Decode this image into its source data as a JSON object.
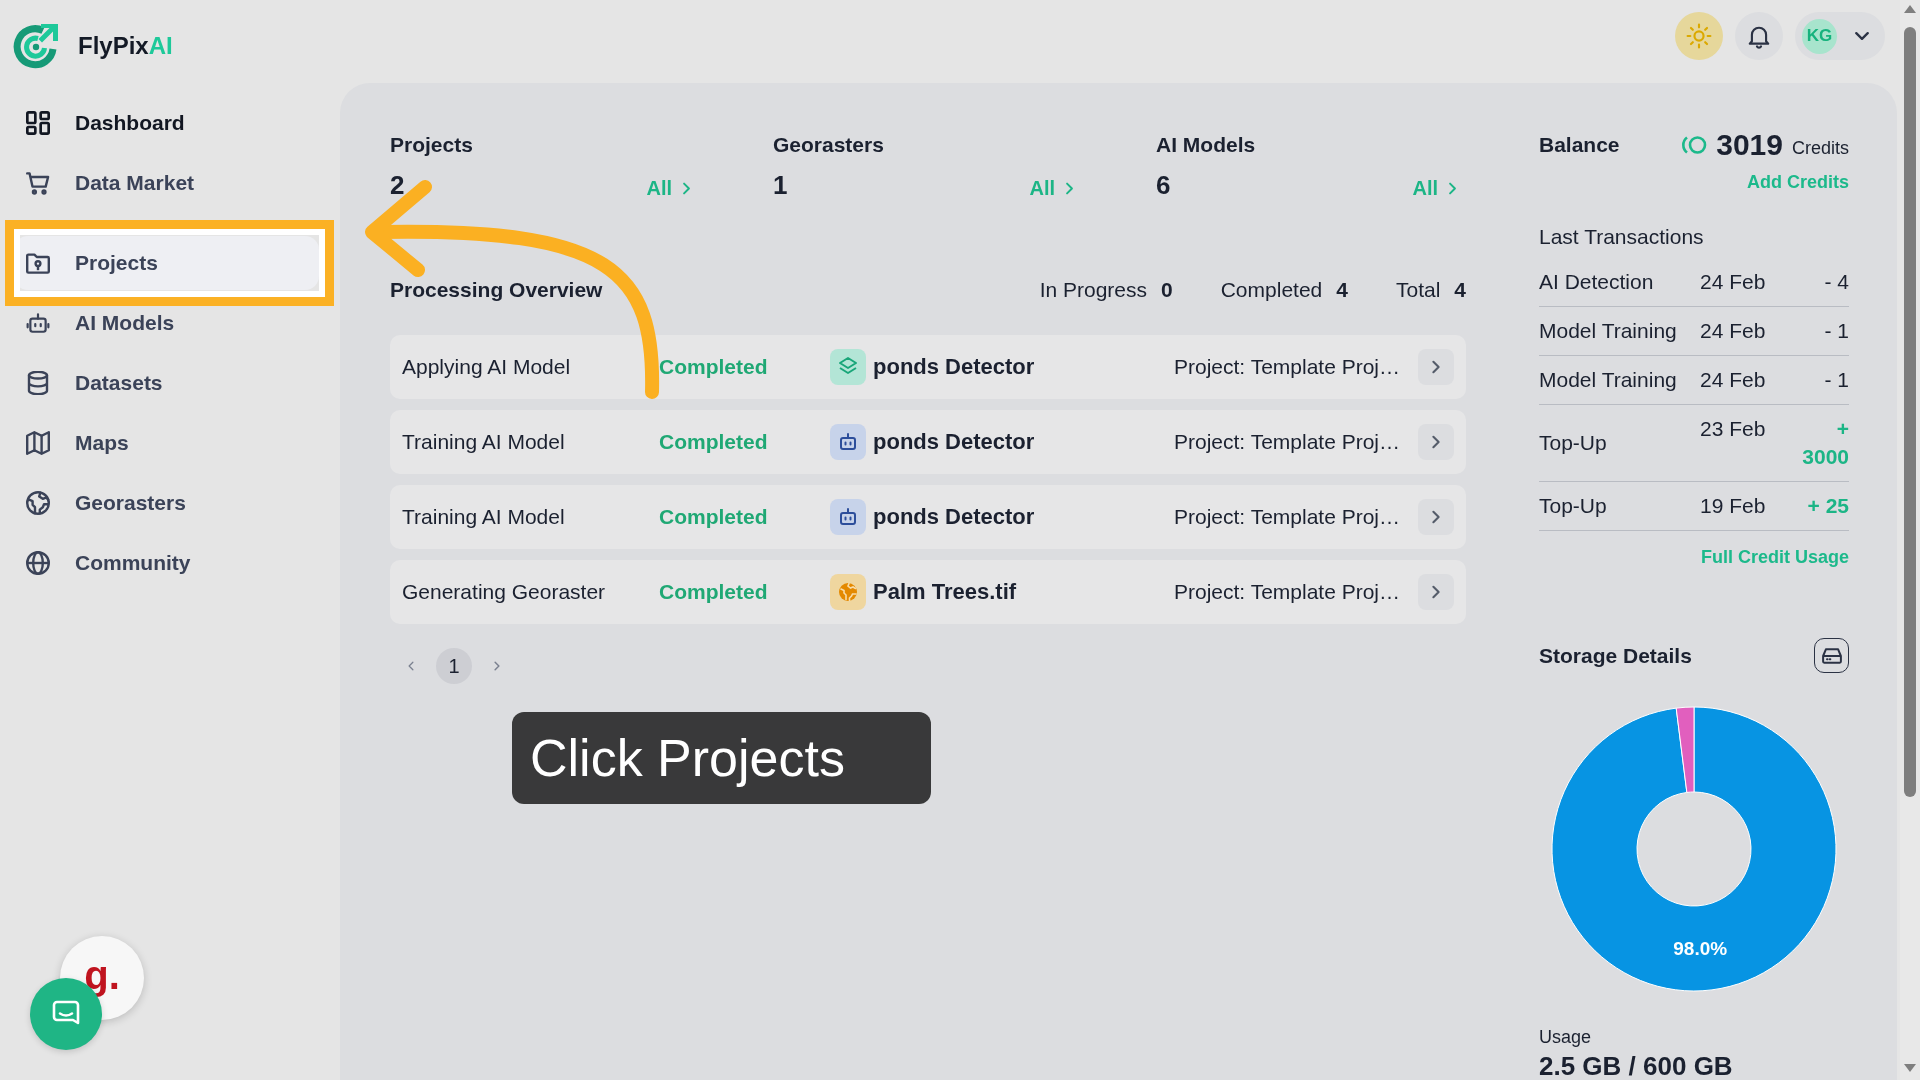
{
  "brand": {
    "name": "FlyPix",
    "accent": "AI"
  },
  "sidebar": {
    "groups": [
      {
        "items": [
          {
            "label": "Dashboard",
            "selected": true,
            "hovered": false,
            "highlighted": false
          },
          {
            "label": "Data Market",
            "selected": false,
            "hovered": false,
            "highlighted": false
          }
        ]
      },
      {
        "items": [
          {
            "label": "Projects",
            "selected": false,
            "hovered": true,
            "highlighted": true
          },
          {
            "label": "AI Models",
            "selected": false,
            "hovered": false,
            "highlighted": false
          },
          {
            "label": "Datasets",
            "selected": false,
            "hovered": false,
            "highlighted": false
          },
          {
            "label": "Maps",
            "selected": false,
            "hovered": false,
            "highlighted": false
          },
          {
            "label": "Georasters",
            "selected": false,
            "hovered": false,
            "highlighted": false
          },
          {
            "label": "Community",
            "selected": false,
            "hovered": false,
            "highlighted": false
          }
        ]
      }
    ]
  },
  "header": {
    "user": {
      "initials": "KG"
    }
  },
  "stats": [
    {
      "label": "Projects",
      "value": "2",
      "link": "All"
    },
    {
      "label": "Georasters",
      "value": "1",
      "link": "All"
    },
    {
      "label": "AI Models",
      "value": "6",
      "link": "All"
    }
  ],
  "processing": {
    "title": "Processing Overview",
    "counters": [
      {
        "label": "In Progress",
        "value": "0"
      },
      {
        "label": "Completed",
        "value": "4"
      },
      {
        "label": "Total",
        "value": "4"
      }
    ],
    "rows": [
      {
        "kind": "applying",
        "task": "Applying AI Model",
        "status": "Completed",
        "name": "ponds Detector",
        "project": "Project: Template Proj…"
      },
      {
        "kind": "training",
        "task": "Training AI Model",
        "status": "Completed",
        "name": "ponds Detector",
        "project": "Project: Template Proj…"
      },
      {
        "kind": "training",
        "task": "Training AI Model",
        "status": "Completed",
        "name": "ponds Detector",
        "project": "Project: Template Proj…"
      },
      {
        "kind": "georaster",
        "task": "Generating Georaster",
        "status": "Completed",
        "name": "Palm Trees.tif",
        "project": "Project: Template Proj…"
      }
    ],
    "pagination": {
      "pages": [
        {
          "label": "1",
          "selected": true
        }
      ]
    }
  },
  "balance": {
    "title": "Balance",
    "amount": "3019",
    "unit": "Credits",
    "action": "Add Credits"
  },
  "transactions": {
    "title": "Last Transactions",
    "rows": [
      {
        "kind": "debit",
        "label": "AI Detection",
        "date": "24 Feb",
        "amount": "- 4"
      },
      {
        "kind": "debit",
        "label": "Model Training",
        "date": "24 Feb",
        "amount": "- 1"
      },
      {
        "kind": "debit",
        "label": "Model Training",
        "date": "24 Feb",
        "amount": "- 1"
      },
      {
        "kind": "credit",
        "label": "Top-Up",
        "date": "23 Feb",
        "amount": "+ 3000"
      },
      {
        "kind": "credit",
        "label": "Top-Up",
        "date": "19 Feb",
        "amount": "+ 25"
      }
    ],
    "link": "Full Credit Usage"
  },
  "storage": {
    "title": "Storage Details",
    "chart_data": {
      "type": "donut",
      "values": [
        98.0,
        2.0
      ],
      "value_labels": [
        "98.0%",
        null
      ]
    },
    "usage_label": "Usage",
    "usage_value": "2.5 GB / 600 GB"
  },
  "tutorial": {
    "callout": "Click Projects"
  },
  "widgets": {
    "badge": "g."
  }
}
